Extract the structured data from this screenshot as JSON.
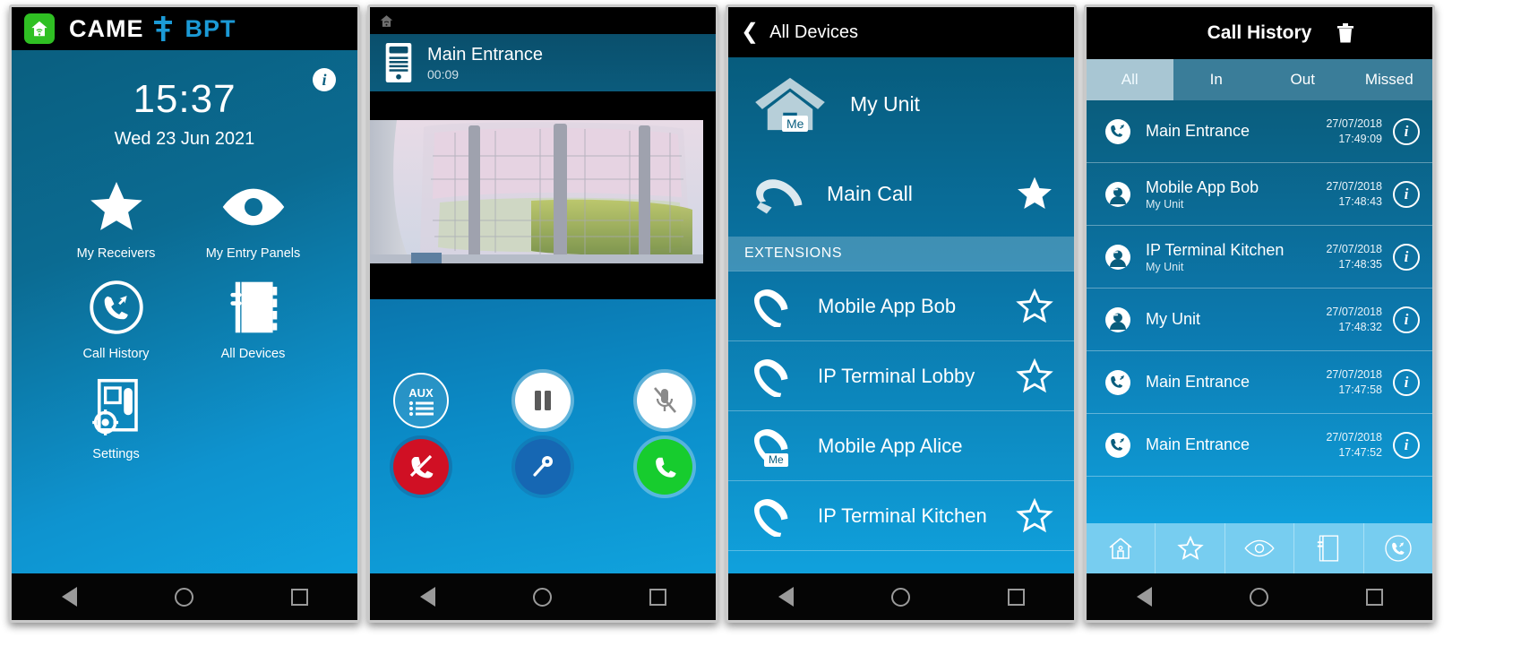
{
  "phone1": {
    "brand": {
      "came": "CAME",
      "bpt": "BPT",
      "house_icon": "house-wifi-icon"
    },
    "info_badge": "i",
    "clock": "15:37",
    "date": "Wed 23 Jun 2021",
    "tiles": [
      {
        "label": "My Receivers",
        "icon": "star-icon"
      },
      {
        "label": "My Entry Panels",
        "icon": "eye-icon"
      },
      {
        "label": "Call History",
        "icon": "call-history-icon"
      },
      {
        "label": "All Devices",
        "icon": "address-book-icon"
      },
      {
        "label": "Settings",
        "icon": "settings-intercom-icon"
      }
    ]
  },
  "phone2": {
    "status_icon": "house-wifi-icon",
    "call": {
      "name": "Main Entrance",
      "timer": "00:09",
      "icon": "entry-panel-icon"
    },
    "controls_row1": [
      {
        "label": "AUX",
        "name": "aux-button",
        "icon": "aux-list-icon"
      },
      {
        "label": "",
        "name": "pause-button",
        "icon": "pause-icon"
      },
      {
        "label": "",
        "name": "mute-button",
        "icon": "mic-muted-icon"
      }
    ],
    "controls_row2": [
      {
        "label": "",
        "name": "hangup-button",
        "icon": "phone-hangup-icon"
      },
      {
        "label": "",
        "name": "door-open-button",
        "icon": "key-icon"
      },
      {
        "label": "",
        "name": "answer-button",
        "icon": "phone-answer-icon"
      }
    ]
  },
  "phone3": {
    "title": "All Devices",
    "back_icon": "chevron-left-icon",
    "unit": {
      "name": "My Unit",
      "badge": "Me",
      "icon": "home-icon"
    },
    "main_call": {
      "name": "Main Call",
      "icon": "handset-icon",
      "favorite": true
    },
    "section_header": "EXTENSIONS",
    "extensions": [
      {
        "name": "Mobile App Bob",
        "favorite": false,
        "me": false
      },
      {
        "name": "IP Terminal Lobby",
        "favorite": false,
        "me": false
      },
      {
        "name": "Mobile App Alice",
        "favorite": false,
        "me": true
      },
      {
        "name": "IP Terminal Kitchen",
        "favorite": false,
        "me": false
      }
    ]
  },
  "phone4": {
    "title": "Call History",
    "trash_icon": "trash-icon",
    "tabs": [
      {
        "label": "All",
        "active": true
      },
      {
        "label": "In",
        "active": false
      },
      {
        "label": "Out",
        "active": false
      },
      {
        "label": "Missed",
        "active": false
      }
    ],
    "entries": [
      {
        "name": "Main Entrance",
        "sub": "",
        "date": "27/07/2018",
        "time": "17:49:09",
        "icon": "call-incoming-icon",
        "info": "i"
      },
      {
        "name": "Mobile App Bob",
        "sub": "My Unit",
        "date": "27/07/2018",
        "time": "17:48:43",
        "icon": "user-call-icon",
        "info": "i"
      },
      {
        "name": "IP Terminal Kitchen",
        "sub": "My Unit",
        "date": "27/07/2018",
        "time": "17:48:35",
        "icon": "user-call-icon",
        "info": "i"
      },
      {
        "name": "My Unit",
        "sub": "",
        "date": "27/07/2018",
        "time": "17:48:32",
        "icon": "user-call-icon",
        "info": "i"
      },
      {
        "name": "Main Entrance",
        "sub": "",
        "date": "27/07/2018",
        "time": "17:47:58",
        "icon": "call-incoming-icon",
        "info": "i"
      },
      {
        "name": "Main Entrance",
        "sub": "",
        "date": "27/07/2018",
        "time": "17:47:52",
        "icon": "call-incoming-icon",
        "info": "i"
      }
    ],
    "bottom_nav": [
      {
        "icon": "home-outline-icon",
        "name": "nav-home"
      },
      {
        "icon": "star-outline-icon",
        "name": "nav-favorites"
      },
      {
        "icon": "eye-outline-icon",
        "name": "nav-entry-panels"
      },
      {
        "icon": "book-outline-icon",
        "name": "nav-all-devices"
      },
      {
        "icon": "call-history-outline-icon",
        "name": "nav-call-history"
      }
    ]
  },
  "android_nav": {
    "back": "back-icon",
    "home": "home-icon",
    "recents": "recents-icon"
  },
  "colors": {
    "accent": "#0fa0dc",
    "dark": "#0a5d7d",
    "brand_blue": "#1b9ad6",
    "green": "#2fc023",
    "red": "#d01024"
  }
}
